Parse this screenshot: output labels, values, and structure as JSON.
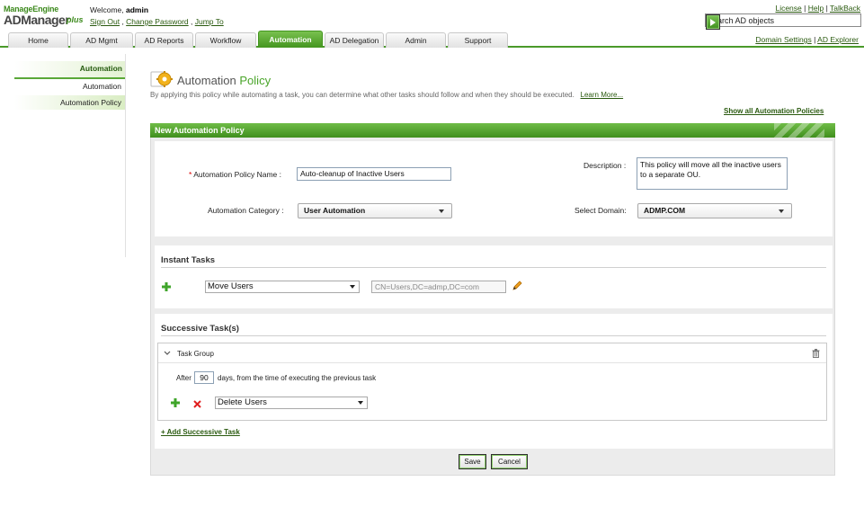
{
  "header": {
    "logo_company": "ManageEngine",
    "logo_product": "ADManager",
    "logo_plus": "plus",
    "welcome_label": "Welcome,",
    "user": "admin",
    "sign_out": "Sign Out",
    "change_password": "Change Password",
    "jump_to": "Jump To",
    "license": "License",
    "help": "Help",
    "talkback": "TalkBack",
    "search_placeholder": "Search AD objects"
  },
  "tabs": [
    {
      "label": "Home"
    },
    {
      "label": "AD Mgmt"
    },
    {
      "label": "AD Reports"
    },
    {
      "label": "Workflow"
    },
    {
      "label": "Automation"
    },
    {
      "label": "AD Delegation"
    },
    {
      "label": "Admin"
    },
    {
      "label": "Support"
    }
  ],
  "bar_links": {
    "domain_settings": "Domain Settings",
    "ad_explorer": "AD Explorer"
  },
  "sidebar": {
    "heading": "Automation",
    "items": [
      {
        "label": "Automation"
      },
      {
        "label": "Automation Policy"
      }
    ]
  },
  "page": {
    "title_prefix": "Automation",
    "title_suffix": "Policy",
    "description": "By applying this policy while automating a task, you can determine what other tasks should follow and when they should be executed.",
    "learn_more": "Learn More...",
    "show_all": "Show all Automation Policies"
  },
  "form": {
    "panel_title": "New Automation Policy",
    "name_label": "Automation Policy Name :",
    "name_value": "Auto-cleanup of Inactive Users",
    "description_label": "Description :",
    "description_value": "This policy will move all the inactive users to a separate OU.",
    "category_label": "Automation Category :",
    "category_value": "User Automation",
    "domain_label": "Select Domain:",
    "domain_value": "ADMP.COM"
  },
  "instant_tasks": {
    "title": "Instant Tasks",
    "task_value": "Move Users",
    "container_value": "CN=Users,DC=admp,DC=com"
  },
  "successive": {
    "title": "Successive Task(s)",
    "group_label": "Task Group",
    "after_label": "After",
    "days_value": "90",
    "days_suffix": "days, from the time of executing the previous task",
    "task_value": "Delete Users",
    "add_link": "+ Add Successive Task"
  },
  "buttons": {
    "save": "Save",
    "cancel": "Cancel"
  },
  "colors": {
    "accent": "#4a9a2a",
    "header_green": "#3f8f1d",
    "link_green": "#2a5a0f"
  }
}
